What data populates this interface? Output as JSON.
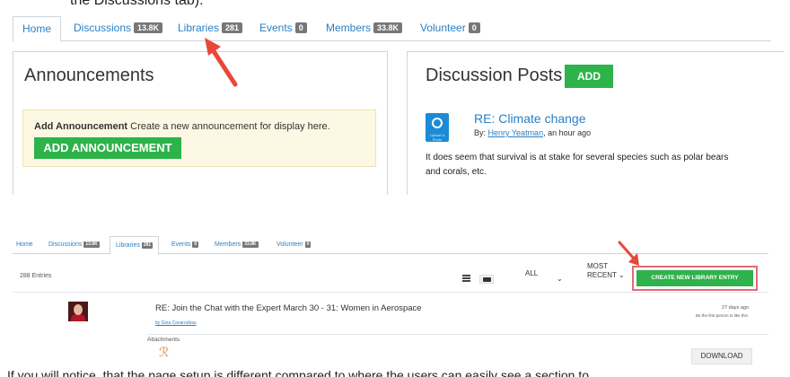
{
  "document": {
    "top_text": "the Discussions tab).",
    "bottom_text": "If you will notice, that the page setup is different compared to where the users can easily see a section to"
  },
  "screen1": {
    "tabs": [
      {
        "label": "Home",
        "badge": ""
      },
      {
        "label": "Discussions",
        "badge": "13.8K"
      },
      {
        "label": "Libraries",
        "badge": "281"
      },
      {
        "label": "Events",
        "badge": "0"
      },
      {
        "label": "Members",
        "badge": "33.8K"
      },
      {
        "label": "Volunteer",
        "badge": "0"
      }
    ],
    "announcements": {
      "title": "Announcements",
      "notice_bold": "Add Announcement",
      "notice_text": "Create a new announcement for display here.",
      "button_label": "ADD ANNOUNCEMENT"
    },
    "discussion_posts": {
      "title": "Discussion Posts",
      "add_label": "ADD",
      "avatar_caption": "Upload a Photo",
      "post_title": "RE: Climate change",
      "by_prefix": "By:",
      "author": "Henry Yeatman",
      "time": ", an hour ago",
      "body_line1": "It does seem that survival is at stake for several species such as polar bears",
      "body_line2": "and corals, etc."
    }
  },
  "screen2": {
    "tabs": [
      {
        "label": "Home",
        "badge": ""
      },
      {
        "label": "Discussions",
        "badge": "13.8K"
      },
      {
        "label": "Libraries",
        "badge": "281"
      },
      {
        "label": "Events",
        "badge": "0"
      },
      {
        "label": "Members",
        "badge": "33.8K"
      },
      {
        "label": "Volunteer",
        "badge": "0"
      }
    ],
    "entries_count": "288 Entries",
    "filter_all": "ALL",
    "sort_line1": "MOST",
    "sort_line2": "RECENT",
    "create_label": "CREATE NEW LIBRARY ENTRY",
    "entry": {
      "title": "RE: Join the Chat with the Expert March 30 - 31: Women in Aerospace",
      "by": "by Gina Covarrubias",
      "time": "27 days ago",
      "like_text": "Be the first person to like this.",
      "attachments_label": "Attachments",
      "download_label": "DOWNLOAD"
    }
  },
  "colors": {
    "link": "#2a7fc4",
    "green": "#2db34a",
    "red_arrow": "#e8473a",
    "badge": "#777777"
  }
}
